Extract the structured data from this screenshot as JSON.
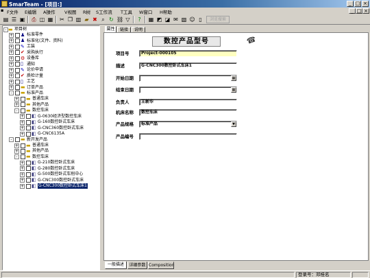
{
  "window": {
    "title": "SmarTeam - [项目:]"
  },
  "menu": [
    "F文件",
    "E编辑",
    "A操作",
    "V视图",
    "R树",
    "S工作流",
    "T工具",
    "W窗口",
    "H帮助"
  ],
  "toolbar": {
    "disabled_button": "浏览搜索"
  },
  "tree": [
    {
      "label": "项目树",
      "level": 0,
      "exp": "-",
      "icon": "folder",
      "cb": false
    },
    {
      "label": "标准零件",
      "level": 1,
      "exp": "+",
      "icon": "person",
      "cb": true
    },
    {
      "label": "标准化(文件、资料)",
      "level": 1,
      "exp": "+",
      "icon": "person",
      "cb": true
    },
    {
      "label": "工装",
      "level": 1,
      "exp": "+",
      "icon": "pin",
      "cb": true
    },
    {
      "label": "采购执行",
      "level": 1,
      "exp": "+",
      "icon": "check",
      "cb": true
    },
    {
      "label": "设备库",
      "level": 1,
      "exp": "+",
      "icon": "gear",
      "cb": true
    },
    {
      "label": "通知",
      "level": 1,
      "exp": "+",
      "icon": "doc",
      "cb": true
    },
    {
      "label": "论价申请",
      "level": 1,
      "exp": "+",
      "icon": "pin",
      "cb": true
    },
    {
      "label": "质检计量",
      "level": 1,
      "exp": "+",
      "icon": "check",
      "cb": true
    },
    {
      "label": "工艺",
      "level": 1,
      "exp": "+",
      "icon": "doc",
      "cb": true
    },
    {
      "label": "订单产品",
      "level": 1,
      "exp": "+",
      "icon": "folder",
      "cb": true
    },
    {
      "label": "标准产品",
      "level": 1,
      "exp": "-",
      "icon": "folder",
      "cb": true
    },
    {
      "label": "普通车床",
      "level": 2,
      "exp": "+",
      "icon": "folder",
      "cb": true
    },
    {
      "label": "其他产品",
      "level": 2,
      "exp": "+",
      "icon": "folder",
      "cb": true
    },
    {
      "label": "数控车床",
      "level": 2,
      "exp": "-",
      "icon": "folder",
      "cb": true
    },
    {
      "label": "G-0630经济型数控车床",
      "level": 3,
      "exp": "+",
      "icon": "part",
      "cb": true
    },
    {
      "label": "G-160数控卧式车床",
      "level": 3,
      "exp": "+",
      "icon": "part",
      "cb": true
    },
    {
      "label": "G-CNC360数控卧式车床",
      "level": 3,
      "exp": "+",
      "icon": "part",
      "cb": true
    },
    {
      "label": "G-CNC6135A",
      "level": 3,
      "exp": "+",
      "icon": "part",
      "cb": true
    },
    {
      "label": "新开发产品",
      "level": 1,
      "exp": "-",
      "icon": "folder",
      "cb": true
    },
    {
      "label": "普通车床",
      "level": 2,
      "exp": "+",
      "icon": "folder",
      "cb": true
    },
    {
      "label": "其他产品",
      "level": 2,
      "exp": "+",
      "icon": "folder",
      "cb": true
    },
    {
      "label": "数控车床",
      "level": 2,
      "exp": "-",
      "icon": "folder",
      "cb": true
    },
    {
      "label": "G-210数控卧式车床",
      "level": 3,
      "exp": "+",
      "icon": "part",
      "cb": true
    },
    {
      "label": "G-280数控卧式车床",
      "level": 3,
      "exp": "+",
      "icon": "part",
      "cb": true
    },
    {
      "label": "G-500数控卧式车削中心",
      "level": 3,
      "exp": "+",
      "icon": "part",
      "cb": true
    },
    {
      "label": "G-CNC300数控卧式车床",
      "level": 3,
      "exp": "+",
      "icon": "part",
      "cb": true
    },
    {
      "label": "G-CNC300数控卧式车床1",
      "level": 3,
      "exp": "+",
      "icon": "part",
      "cb": true,
      "selected": true
    }
  ],
  "tabs": [
    "属性",
    "链接",
    "说明"
  ],
  "form": {
    "title": "数控产品型号",
    "fields": [
      {
        "label": "项目号",
        "value": "Project-000105"
      },
      {
        "label": "描述",
        "value": "G-CNC300数控卧式车床1"
      },
      {
        "label": "开始日期",
        "value": ""
      },
      {
        "label": "结束日期",
        "value": ""
      },
      {
        "label": "负责人",
        "value": "王新华"
      },
      {
        "label": "机床名称",
        "value": "数控车床"
      },
      {
        "label": "产品规格",
        "value": "标准产品"
      },
      {
        "label": "产品编号",
        "value": ""
      }
    ]
  },
  "bottom_tabs": [
    "一般描述",
    "详细参数",
    "Composition"
  ],
  "status": {
    "login": "登录号：邓桂名"
  },
  "colors": {
    "title_start": "#0a246a",
    "selection": "#0a246a",
    "highlight_field": "#ffffc0"
  }
}
